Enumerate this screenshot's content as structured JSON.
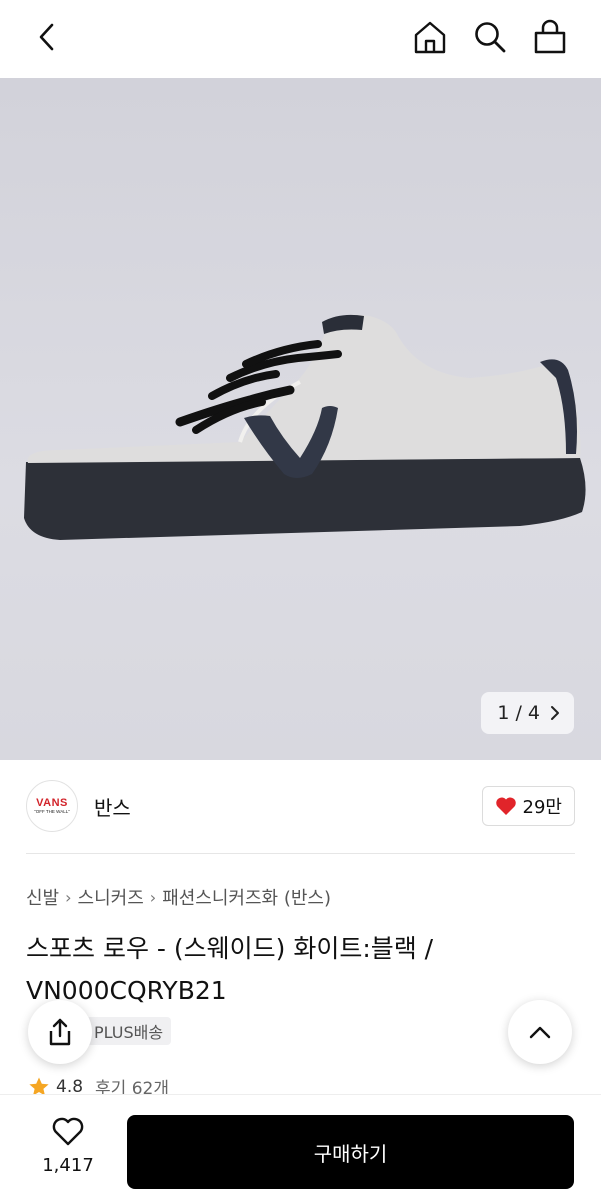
{
  "header": {
    "back_icon": "chevron-left-icon",
    "icons": [
      "home-icon",
      "search-icon",
      "shopping-bag-icon"
    ]
  },
  "gallery": {
    "counter": "1 / 4",
    "current": 1,
    "total": 4,
    "next_icon": "chevron-right-icon"
  },
  "brand": {
    "logo_text": "VANS",
    "logo_subtext": "\"OFF THE WALL\"",
    "name": "반스",
    "likes": "29만",
    "like_icon": "heart-filled-icon",
    "like_color": "#e1242a"
  },
  "breadcrumb": [
    "신발",
    "스니커즈",
    "패션스니커즈화 (반스)"
  ],
  "product": {
    "title": "스포츠 로우 - (스웨이드) 화이트:블랙 / VN000CQRYB21",
    "delivery_badge": "PLUS배송",
    "rating": "4.8",
    "reviews": "후기 62개",
    "star_color": "#f5a623"
  },
  "floating": {
    "share_icon": "share-icon",
    "scroll_top_icon": "chevron-up-icon"
  },
  "bottom": {
    "wish_count": "1,417",
    "wish_icon": "heart-outline-icon",
    "buy_label": "구매하기",
    "buy_color": "#000000"
  }
}
